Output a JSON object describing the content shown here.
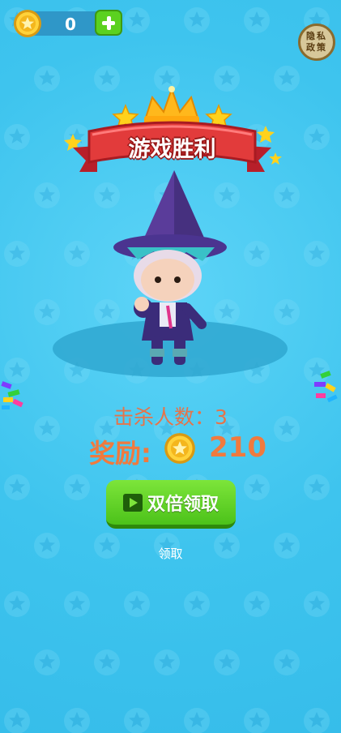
{
  "hud": {
    "coins": "0"
  },
  "privacy": {
    "label": "隐私政策"
  },
  "banner": {
    "title": "游戏胜利"
  },
  "result": {
    "kills_label": "击杀人数：3",
    "reward_label": "奖励:",
    "reward_amount": "210"
  },
  "buttons": {
    "double_claim": "双倍领取",
    "claim": "领取"
  },
  "colors": {
    "background": "#3ec6f0",
    "reward_text": "#f07a3e",
    "button_green": "#5bd11f",
    "banner_red": "#e23b3b"
  },
  "icons": [
    "coin-icon",
    "plus-icon",
    "star-icon",
    "crown-icon",
    "play-icon"
  ]
}
